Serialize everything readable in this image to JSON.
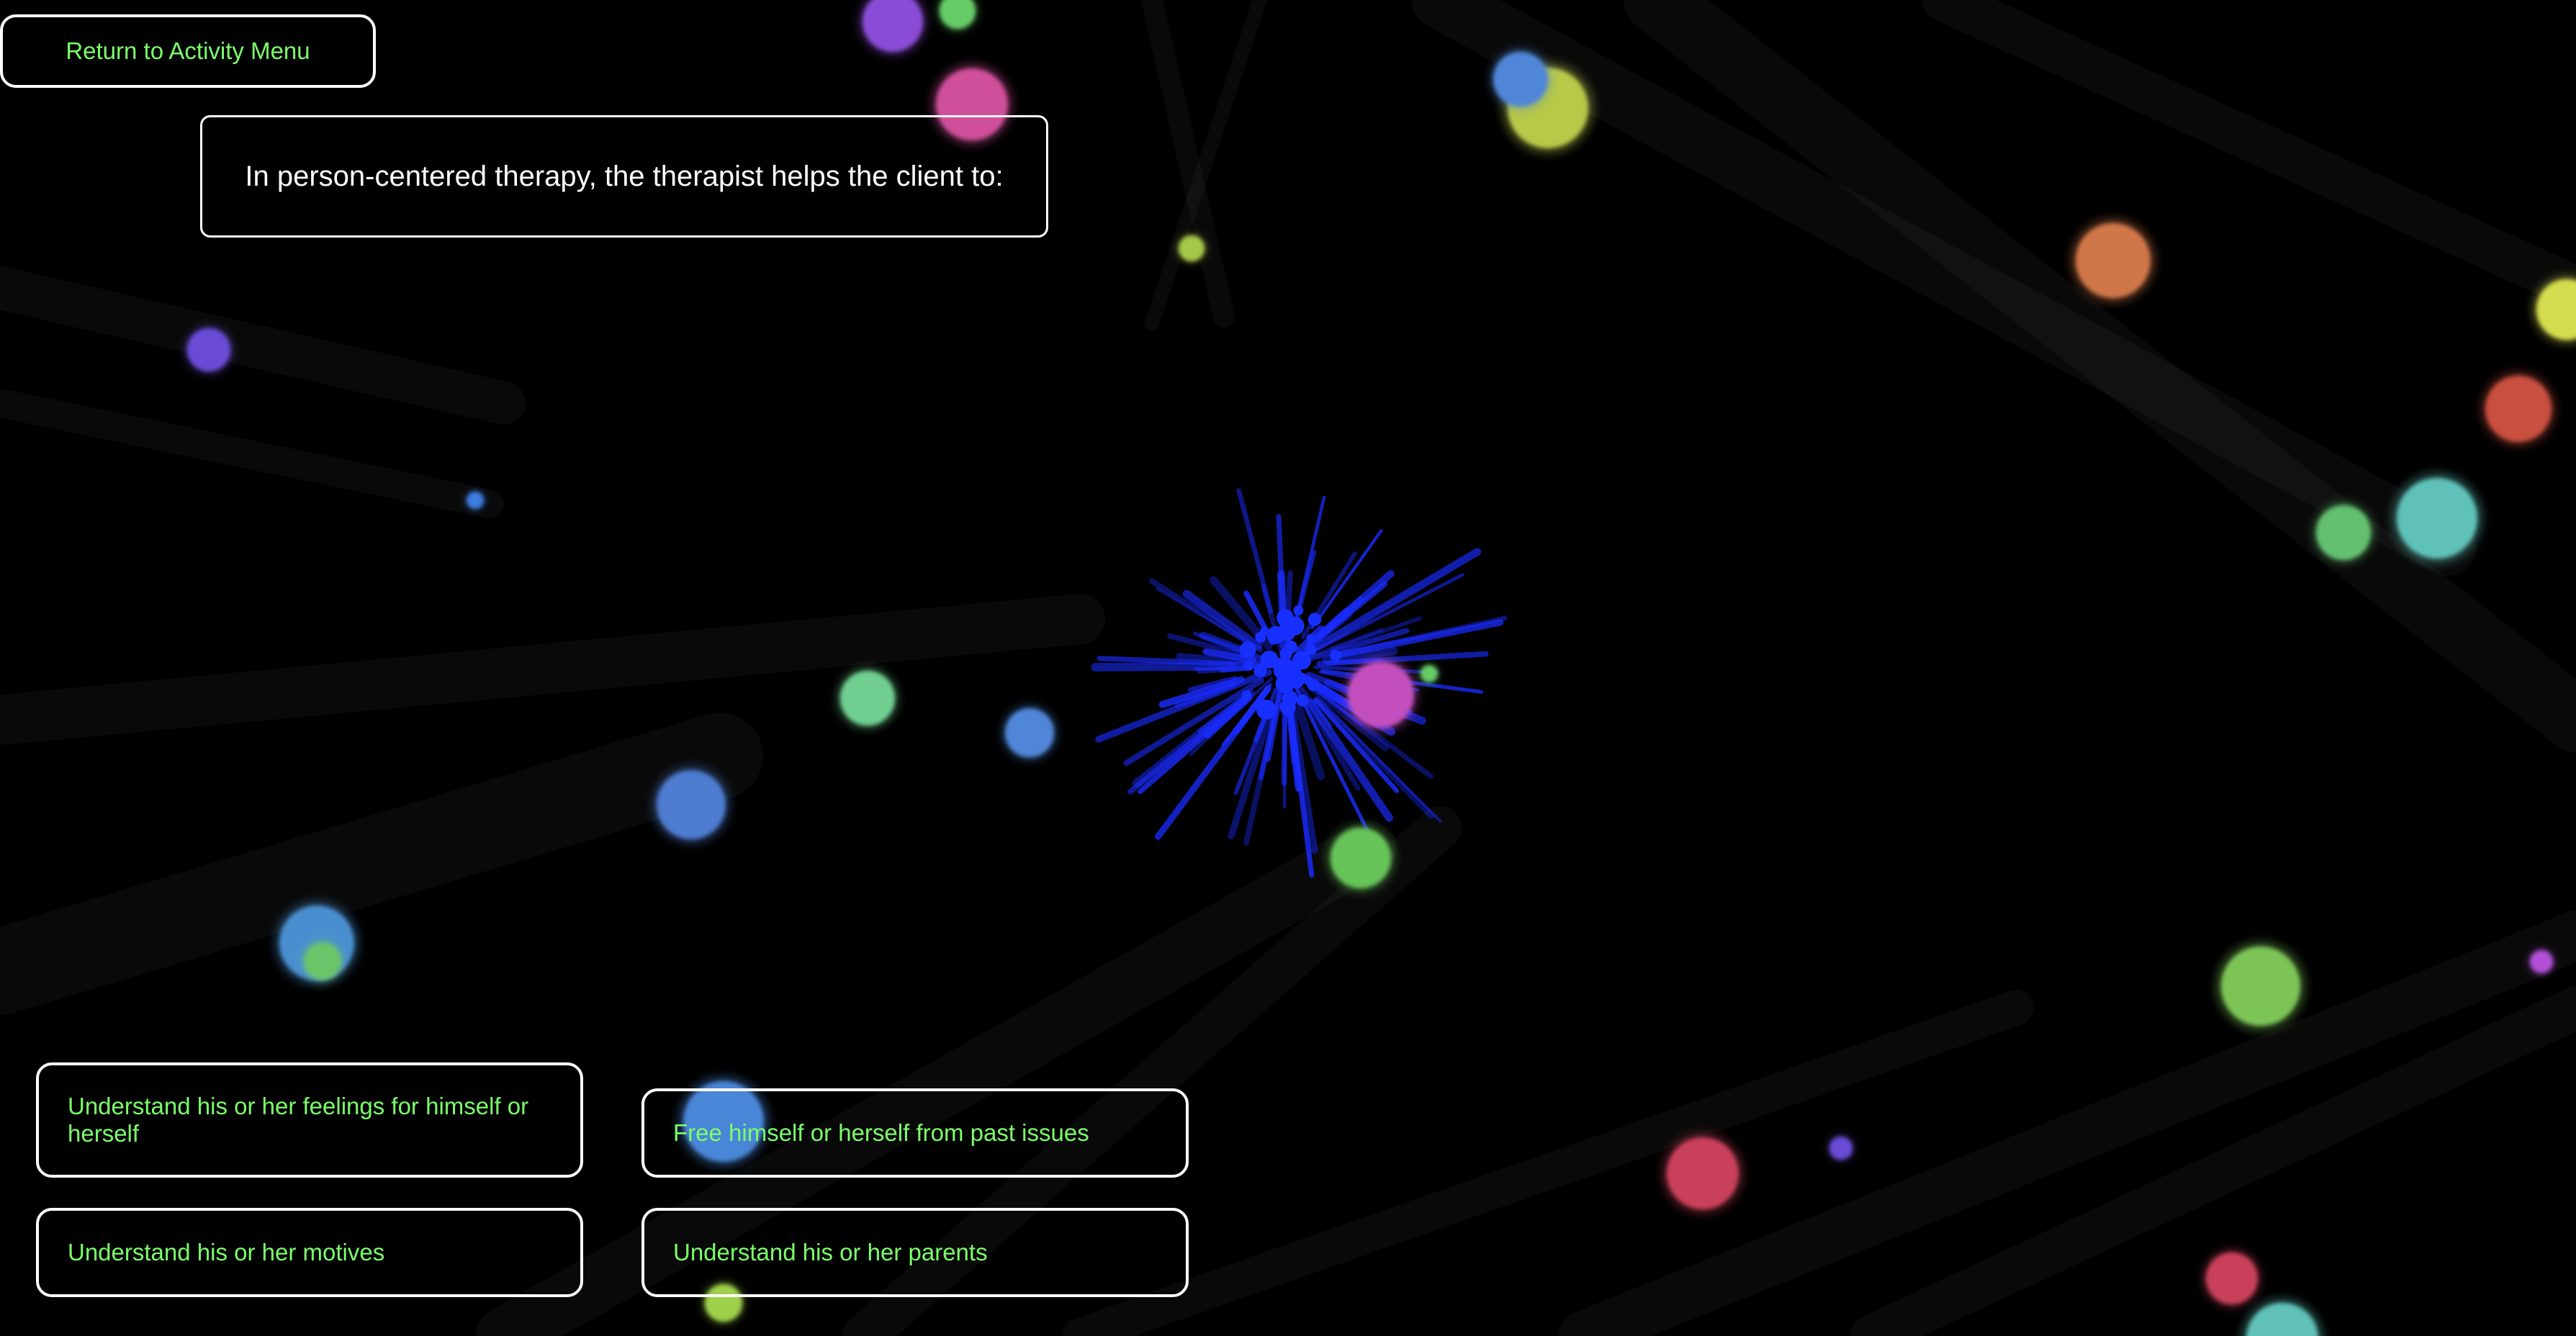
{
  "navigation": {
    "return_label": "Return to Activity Menu"
  },
  "question": {
    "text": "In person-centered therapy, the therapist helps the client to:"
  },
  "answers": [
    {
      "label": "Understand his or her feelings for himself or herself"
    },
    {
      "label": "Free himself or herself from past issues"
    },
    {
      "label": "Understand his or her motives"
    },
    {
      "label": "Understand his or her parents"
    }
  ],
  "theme": {
    "background": "#000000",
    "button_text": "#7cff6b",
    "border": "#ffffff",
    "question_text": "#ffffff",
    "burst_color": "#1a2cff"
  }
}
